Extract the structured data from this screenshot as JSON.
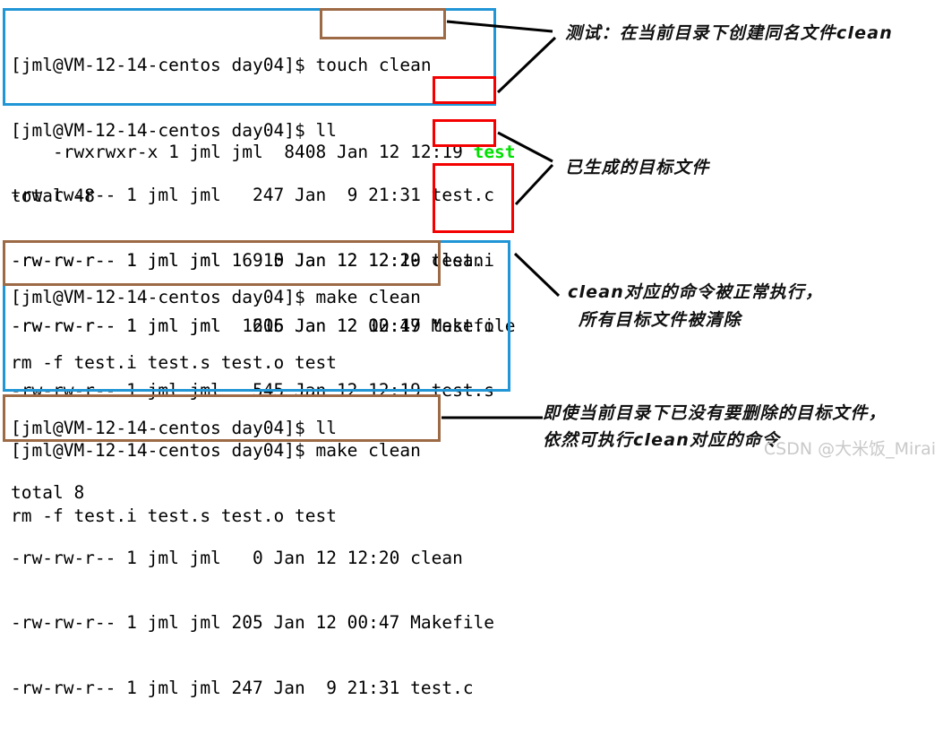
{
  "terminal": {
    "block1": [
      "[jml@VM-12-14-centos day04]$ touch clean",
      "[jml@VM-12-14-centos day04]$ ll",
      "total 48",
      "-rw-rw-r-- 1 jml jml     0 Jan 12 12:20 clean",
      "-rw-rw-r-- 1 jml jml   205 Jan 12 00:47 Makefile"
    ],
    "line_test_prefix": "-rwxrwxr-x 1 jml jml  8408 Jan 12 12:19 ",
    "line_test_name": "test",
    "block2": [
      "-rw-rw-r-- 1 jml jml   247 Jan  9 21:31 test.c",
      "-rw-rw-r-- 1 jml jml 16915 Jan 12 12:19 test.i",
      "-rw-rw-r-- 1 jml jml  1616 Jan 12 12:19 test.o",
      "-rw-rw-r-- 1 jml jml   545 Jan 12 12:19 test.s"
    ],
    "block3": [
      "[jml@VM-12-14-centos day04]$ make clean",
      "rm -f test.i test.s test.o test",
      "[jml@VM-12-14-centos day04]$ ll",
      "total 8",
      "-rw-rw-r-- 1 jml jml   0 Jan 12 12:20 clean",
      "-rw-rw-r-- 1 jml jml 205 Jan 12 00:47 Makefile",
      "-rw-rw-r-- 1 jml jml 247 Jan  9 21:31 test.c"
    ],
    "block4": [
      "[jml@VM-12-14-centos day04]$ make clean",
      "rm -f test.i test.s test.o test"
    ]
  },
  "annotations": {
    "note1": "测试：在当前目录下创建同名文件clean",
    "note2": "已生成的目标文件",
    "note3_line1": "clean对应的命令被正常执行，",
    "note3_line2": "所有目标文件被清除",
    "note4_line1": "即使当前目录下已没有要删除的目标文件，",
    "note4_line2": "依然可执行clean对应的命令"
  },
  "watermark": "CSDN @大米饭_Mirai",
  "colors": {
    "highlight_blue": "#2196d6",
    "highlight_red": "#f40000",
    "highlight_brown": "#9d6a46",
    "terminal_text": "#000000",
    "executable_green": "#00e000",
    "watermark_gray": "#c9c9c9"
  }
}
